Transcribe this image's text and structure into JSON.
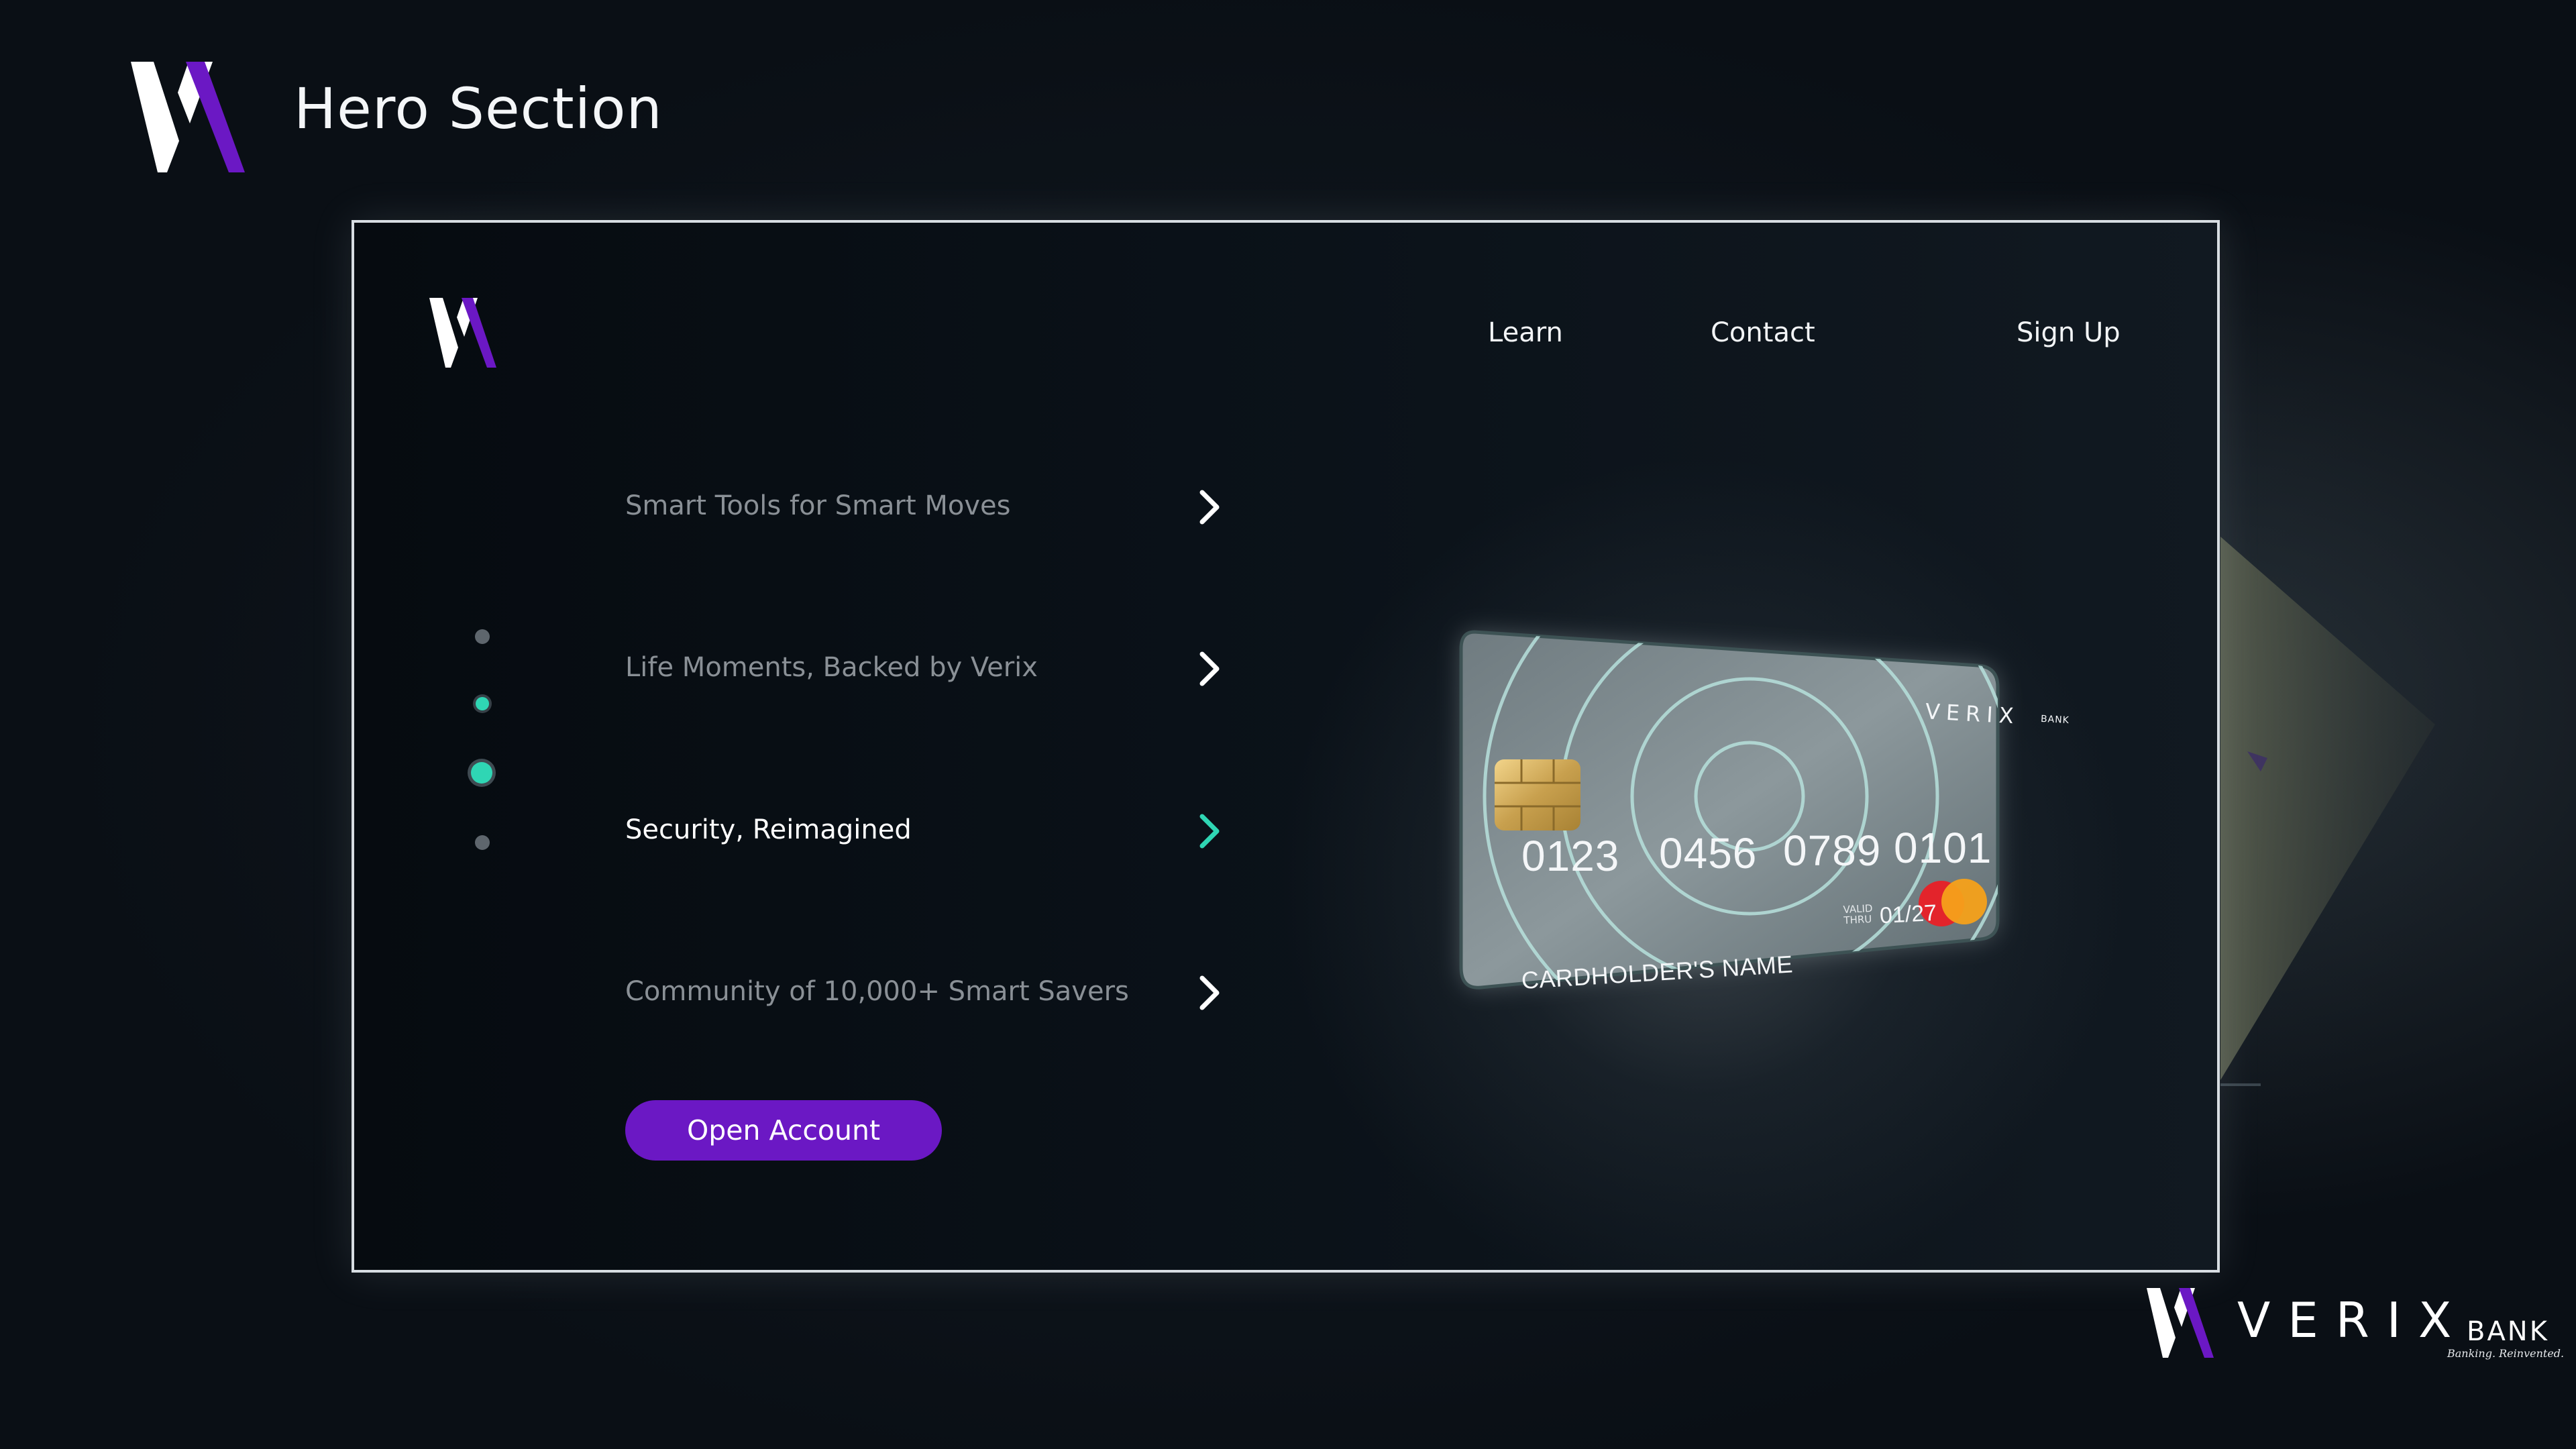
{
  "page": {
    "title": "Hero Section"
  },
  "colors": {
    "accent_purple": "#6b18c4",
    "accent_teal": "#2fd6b4",
    "background": "#0b1016",
    "frame_border": "#d7dde2"
  },
  "icons": {
    "logo": "vx-logo-icon",
    "chevron": "chevron-right-icon",
    "card_chip": "card-chip-icon",
    "card_network": "mastercard-logo-icon"
  },
  "nav": {
    "items": [
      {
        "label": "Learn"
      },
      {
        "label": "Contact"
      },
      {
        "label": "Sign Up"
      }
    ]
  },
  "features": {
    "items": [
      {
        "label": "Smart Tools for Smart Moves",
        "active": false
      },
      {
        "label": "Life Moments, Backed by Verix",
        "active": false
      },
      {
        "label": "Security, Reimagined",
        "active": true
      },
      {
        "label": "Community of 10,000+ Smart Savers",
        "active": false
      }
    ]
  },
  "progress": {
    "total": 4,
    "current": 3
  },
  "cta": {
    "label": "Open Account"
  },
  "card": {
    "brand": "VERIX",
    "brand_suffix": "BANK",
    "number_groups": [
      "0123",
      "0456",
      "0789",
      "0101"
    ],
    "valid_label_line1": "VALID",
    "valid_label_line2": "THRU",
    "expiry": "01/27",
    "holder": "CARDHOLDER'S NAME"
  },
  "footer_brand": {
    "name": "VERIX",
    "suffix": "BANK",
    "tagline": "Banking. Reinvented."
  }
}
